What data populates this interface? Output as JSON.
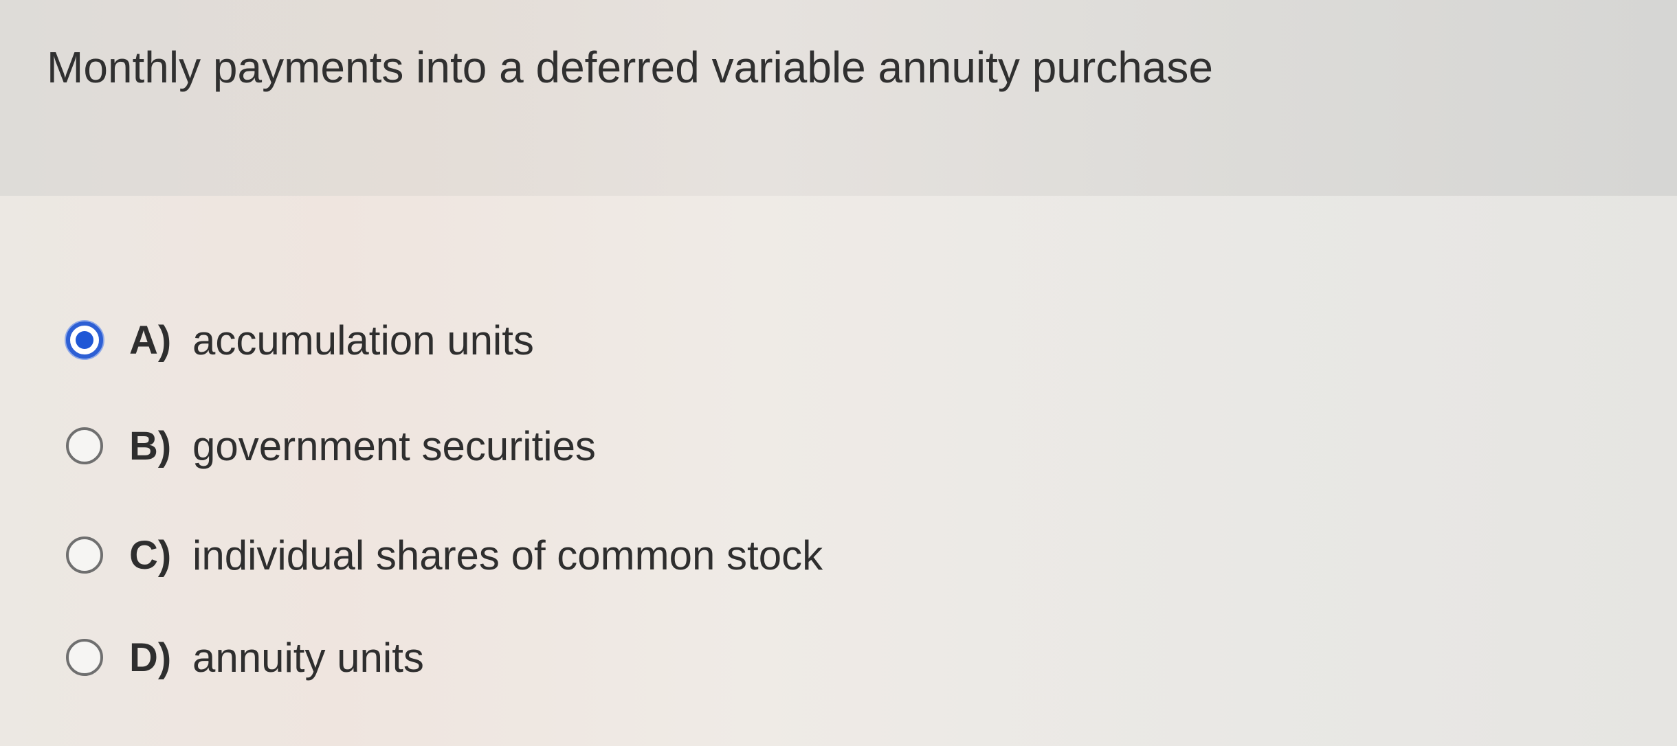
{
  "question": {
    "text": "Monthly payments into a deferred variable annuity purchase"
  },
  "options": [
    {
      "letter": "A)",
      "label": "accumulation units",
      "selected": true
    },
    {
      "letter": "B)",
      "label": "government securities",
      "selected": false
    },
    {
      "letter": "C)",
      "label": "individual shares of common stock",
      "selected": false
    },
    {
      "letter": "D)",
      "label": "annuity units",
      "selected": false
    }
  ],
  "colors": {
    "selected_radio": "#1f57d6"
  }
}
